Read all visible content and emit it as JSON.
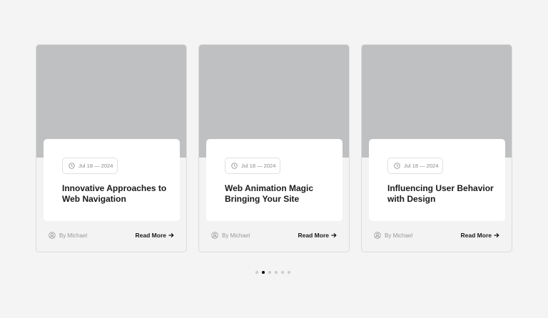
{
  "cards": [
    {
      "date": "Jul 18 — 2024",
      "title": "Innovative Approaches to Web Navigation",
      "author": "By Michael",
      "read_more": "Read More"
    },
    {
      "date": "Jul 18 — 2024",
      "title": "Web Animation Magic Bringing Your Site",
      "author": "By Michael",
      "read_more": "Read More"
    },
    {
      "date": "Jul 18 — 2024",
      "title": "Influencing User Behavior with Design",
      "author": "By Michael",
      "read_more": "Read More"
    }
  ],
  "pagination": {
    "count": 6,
    "active_index": 1
  }
}
